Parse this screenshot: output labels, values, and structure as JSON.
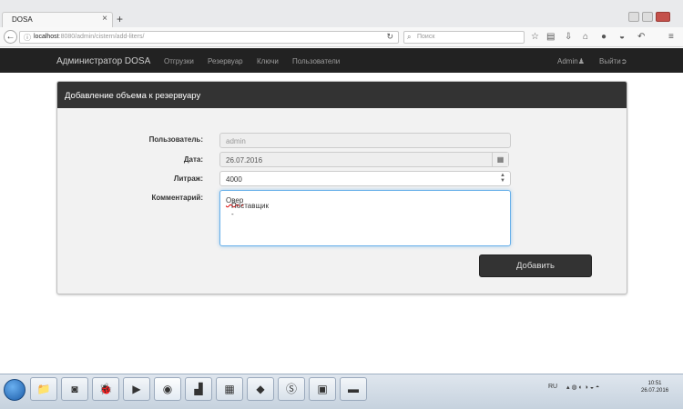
{
  "browser": {
    "tab_title": "DOSA",
    "tab_close": "×",
    "new_tab": "+",
    "url_host": "localhost",
    "url_rest": ":8080/admin/cistern/add-liters/",
    "search_placeholder": "Поиск",
    "toolbar_icons": [
      "star-icon",
      "library-icon",
      "download-icon",
      "home-icon",
      "chat-icon",
      "pocket-icon",
      "back-arrow-icon",
      "menu-icon"
    ]
  },
  "app": {
    "brand": "Администратор DOSA",
    "menu": [
      "Отгрузки",
      "Резервуар",
      "Ключи",
      "Пользователи"
    ],
    "user": "Admin",
    "logout": "Выйти"
  },
  "panel": {
    "title": "Добавление объема к резервуару"
  },
  "form": {
    "user_label": "Пользователь:",
    "user_value": "admin",
    "date_label": "Дата:",
    "date_value": "26.07.2016",
    "liters_label": "Литраж:",
    "liters_value": "4000",
    "comment_label": "Комментарий:",
    "comment_prefix": "Поставщик - ",
    "comment_suffix": "Овер",
    "submit_label": "Добавить"
  },
  "taskbar": {
    "tray_lang": "RU",
    "clock_time": "10:51",
    "clock_date": "26.07.2016"
  },
  "colors": {
    "navbar": "#222222",
    "panel_head": "#333333",
    "focus_border": "#66afe9"
  }
}
